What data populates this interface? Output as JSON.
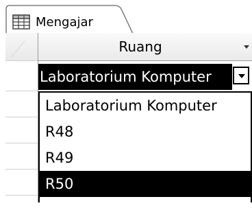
{
  "tab": {
    "label": "Mengajar",
    "icon": "table-icon"
  },
  "column": {
    "header": "Ruang",
    "icon": "dropdown-arrow-icon"
  },
  "combo": {
    "value": "Laboratorium Komputer",
    "icon": "chevron-down-icon"
  },
  "dropdown": {
    "options": [
      "Laboratorium Komputer",
      "R48",
      "R49",
      "R50"
    ],
    "selected_index": 3
  },
  "colors": {
    "highlight": "#000000",
    "highlight_text": "#ffffff",
    "grid": "#9a9a9a"
  }
}
